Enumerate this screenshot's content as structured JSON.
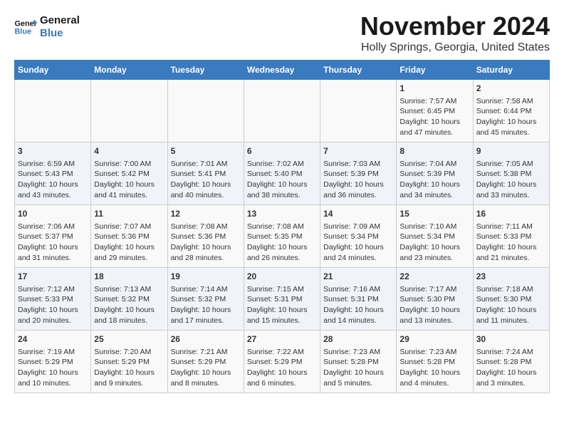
{
  "header": {
    "logo_line1": "General",
    "logo_line2": "Blue",
    "month": "November 2024",
    "location": "Holly Springs, Georgia, United States"
  },
  "weekdays": [
    "Sunday",
    "Monday",
    "Tuesday",
    "Wednesday",
    "Thursday",
    "Friday",
    "Saturday"
  ],
  "weeks": [
    [
      {
        "day": "",
        "info": ""
      },
      {
        "day": "",
        "info": ""
      },
      {
        "day": "",
        "info": ""
      },
      {
        "day": "",
        "info": ""
      },
      {
        "day": "",
        "info": ""
      },
      {
        "day": "1",
        "info": "Sunrise: 7:57 AM\nSunset: 6:45 PM\nDaylight: 10 hours and 47 minutes."
      },
      {
        "day": "2",
        "info": "Sunrise: 7:58 AM\nSunset: 6:44 PM\nDaylight: 10 hours and 45 minutes."
      }
    ],
    [
      {
        "day": "3",
        "info": "Sunrise: 6:59 AM\nSunset: 5:43 PM\nDaylight: 10 hours and 43 minutes."
      },
      {
        "day": "4",
        "info": "Sunrise: 7:00 AM\nSunset: 5:42 PM\nDaylight: 10 hours and 41 minutes."
      },
      {
        "day": "5",
        "info": "Sunrise: 7:01 AM\nSunset: 5:41 PM\nDaylight: 10 hours and 40 minutes."
      },
      {
        "day": "6",
        "info": "Sunrise: 7:02 AM\nSunset: 5:40 PM\nDaylight: 10 hours and 38 minutes."
      },
      {
        "day": "7",
        "info": "Sunrise: 7:03 AM\nSunset: 5:39 PM\nDaylight: 10 hours and 36 minutes."
      },
      {
        "day": "8",
        "info": "Sunrise: 7:04 AM\nSunset: 5:39 PM\nDaylight: 10 hours and 34 minutes."
      },
      {
        "day": "9",
        "info": "Sunrise: 7:05 AM\nSunset: 5:38 PM\nDaylight: 10 hours and 33 minutes."
      }
    ],
    [
      {
        "day": "10",
        "info": "Sunrise: 7:06 AM\nSunset: 5:37 PM\nDaylight: 10 hours and 31 minutes."
      },
      {
        "day": "11",
        "info": "Sunrise: 7:07 AM\nSunset: 5:36 PM\nDaylight: 10 hours and 29 minutes."
      },
      {
        "day": "12",
        "info": "Sunrise: 7:08 AM\nSunset: 5:36 PM\nDaylight: 10 hours and 28 minutes."
      },
      {
        "day": "13",
        "info": "Sunrise: 7:08 AM\nSunset: 5:35 PM\nDaylight: 10 hours and 26 minutes."
      },
      {
        "day": "14",
        "info": "Sunrise: 7:09 AM\nSunset: 5:34 PM\nDaylight: 10 hours and 24 minutes."
      },
      {
        "day": "15",
        "info": "Sunrise: 7:10 AM\nSunset: 5:34 PM\nDaylight: 10 hours and 23 minutes."
      },
      {
        "day": "16",
        "info": "Sunrise: 7:11 AM\nSunset: 5:33 PM\nDaylight: 10 hours and 21 minutes."
      }
    ],
    [
      {
        "day": "17",
        "info": "Sunrise: 7:12 AM\nSunset: 5:33 PM\nDaylight: 10 hours and 20 minutes."
      },
      {
        "day": "18",
        "info": "Sunrise: 7:13 AM\nSunset: 5:32 PM\nDaylight: 10 hours and 18 minutes."
      },
      {
        "day": "19",
        "info": "Sunrise: 7:14 AM\nSunset: 5:32 PM\nDaylight: 10 hours and 17 minutes."
      },
      {
        "day": "20",
        "info": "Sunrise: 7:15 AM\nSunset: 5:31 PM\nDaylight: 10 hours and 15 minutes."
      },
      {
        "day": "21",
        "info": "Sunrise: 7:16 AM\nSunset: 5:31 PM\nDaylight: 10 hours and 14 minutes."
      },
      {
        "day": "22",
        "info": "Sunrise: 7:17 AM\nSunset: 5:30 PM\nDaylight: 10 hours and 13 minutes."
      },
      {
        "day": "23",
        "info": "Sunrise: 7:18 AM\nSunset: 5:30 PM\nDaylight: 10 hours and 11 minutes."
      }
    ],
    [
      {
        "day": "24",
        "info": "Sunrise: 7:19 AM\nSunset: 5:29 PM\nDaylight: 10 hours and 10 minutes."
      },
      {
        "day": "25",
        "info": "Sunrise: 7:20 AM\nSunset: 5:29 PM\nDaylight: 10 hours and 9 minutes."
      },
      {
        "day": "26",
        "info": "Sunrise: 7:21 AM\nSunset: 5:29 PM\nDaylight: 10 hours and 8 minutes."
      },
      {
        "day": "27",
        "info": "Sunrise: 7:22 AM\nSunset: 5:29 PM\nDaylight: 10 hours and 6 minutes."
      },
      {
        "day": "28",
        "info": "Sunrise: 7:23 AM\nSunset: 5:28 PM\nDaylight: 10 hours and 5 minutes."
      },
      {
        "day": "29",
        "info": "Sunrise: 7:23 AM\nSunset: 5:28 PM\nDaylight: 10 hours and 4 minutes."
      },
      {
        "day": "30",
        "info": "Sunrise: 7:24 AM\nSunset: 5:28 PM\nDaylight: 10 hours and 3 minutes."
      }
    ]
  ]
}
